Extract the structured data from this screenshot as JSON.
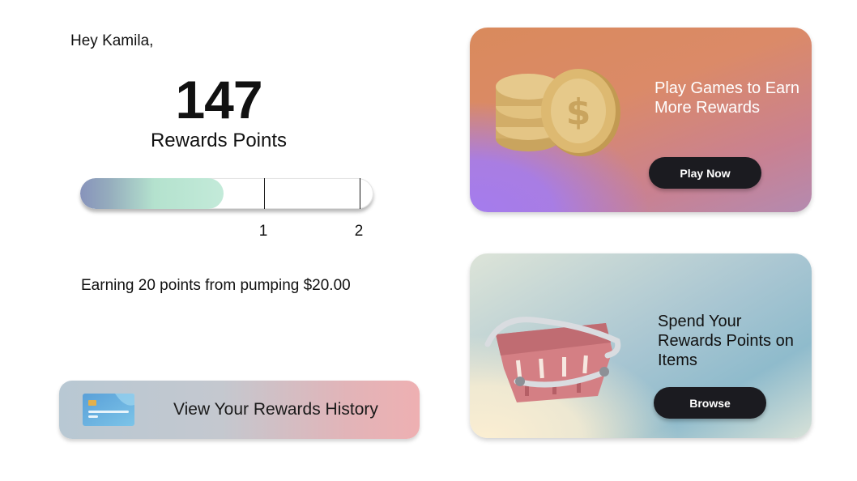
{
  "greeting": "Hey Kamila,",
  "rewards": {
    "points": "147",
    "label": "Rewards Points",
    "progress_fraction": 0.49,
    "tick_labels": [
      "1",
      "2"
    ]
  },
  "earning_text": "Earning 20 points from pumping $20.00",
  "history_button": {
    "label": "View Your Rewards History",
    "icon": "credit-card-icon"
  },
  "games_card": {
    "title": "Play Games to Earn More Rewards",
    "button_label": "Play Now",
    "icon": "coins-icon"
  },
  "shop_card": {
    "title": "Spend Your Rewards Points on Items",
    "button_label": "Browse",
    "icon": "shopping-basket-icon"
  },
  "colors": {
    "button_dark": "#1b1b20",
    "progress_start": "#8793bb",
    "progress_end": "#c3ead9",
    "games_purple": "#a47cee",
    "games_orange": "#d98a5c",
    "shop_blue": "#8fbbcc",
    "history_pink": "#eeb0b2"
  }
}
